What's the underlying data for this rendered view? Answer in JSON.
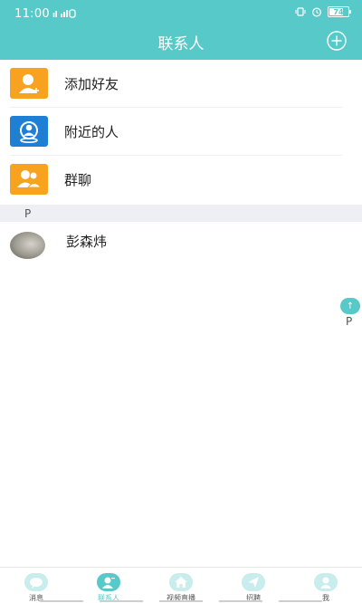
{
  "status_bar": {
    "time": "11:00",
    "network": "₂ᴳıl",
    "battery": "74",
    "battery_level": 0.74
  },
  "header": {
    "title": "联系人",
    "add_icon": "plus-circle-icon"
  },
  "functions": [
    {
      "label": "添加好友",
      "icon": "add-friend-icon",
      "color": "#f7a320"
    },
    {
      "label": "附近的人",
      "icon": "nearby-people-icon",
      "color": "#1e7fd4"
    },
    {
      "label": "群聊",
      "icon": "group-chat-icon",
      "color": "#f7a320"
    }
  ],
  "contacts": {
    "section_letter": "P",
    "items": [
      {
        "name": "彭森炜",
        "avatar": "user-photo"
      }
    ]
  },
  "index_bar": {
    "up_label": "↑",
    "letter": "P"
  },
  "bottom_nav": {
    "tabs": [
      {
        "label": "消息",
        "icon": "chat-bubble-icon",
        "active": false
      },
      {
        "label": "联系人",
        "icon": "contacts-icon",
        "active": true
      },
      {
        "label": "视频直播",
        "icon": "home-icon",
        "active": false
      },
      {
        "label": "招聘",
        "icon": "paper-plane-icon",
        "active": false
      },
      {
        "label": "我",
        "icon": "person-icon",
        "active": false
      }
    ]
  },
  "colors": {
    "accent": "#58c9c9",
    "orange": "#f7a320",
    "blue": "#1e7fd4"
  }
}
